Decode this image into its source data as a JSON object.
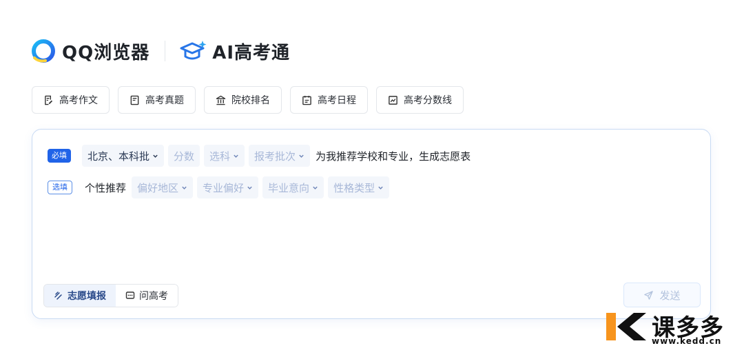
{
  "header": {
    "brand": "QQ浏览器",
    "product": "AI高考通"
  },
  "tabs": [
    {
      "label": "高考作文",
      "icon": "essay-icon"
    },
    {
      "label": "高考真题",
      "icon": "document-icon"
    },
    {
      "label": "院校排名",
      "icon": "institution-icon"
    },
    {
      "label": "高考日程",
      "icon": "calendar-icon"
    },
    {
      "label": "高考分数线",
      "icon": "chart-icon"
    }
  ],
  "form": {
    "required_badge": "必填",
    "optional_badge": "选填",
    "required_chips": [
      {
        "label": "北京、本科批",
        "filled": true,
        "dropdown": true
      },
      {
        "label": "分数",
        "filled": false,
        "dropdown": false
      },
      {
        "label": "选科",
        "filled": false,
        "dropdown": true
      },
      {
        "label": "报考批次",
        "filled": false,
        "dropdown": true
      }
    ],
    "required_suffix": "为我推荐学校和专业，生成志愿表",
    "optional_prefix": "个性推荐",
    "optional_chips": [
      {
        "label": "偏好地区",
        "dropdown": true
      },
      {
        "label": "专业偏好",
        "dropdown": true
      },
      {
        "label": "毕业意向",
        "dropdown": true
      },
      {
        "label": "性格类型",
        "dropdown": true
      }
    ]
  },
  "modes": {
    "fill": "志愿填报",
    "ask": "问高考"
  },
  "send_label": "发送",
  "watermark": {
    "name": "课多多",
    "url": "www.kedd.cn"
  },
  "colors": {
    "accent": "#2063e8",
    "placeholder": "#a8b8d8"
  }
}
